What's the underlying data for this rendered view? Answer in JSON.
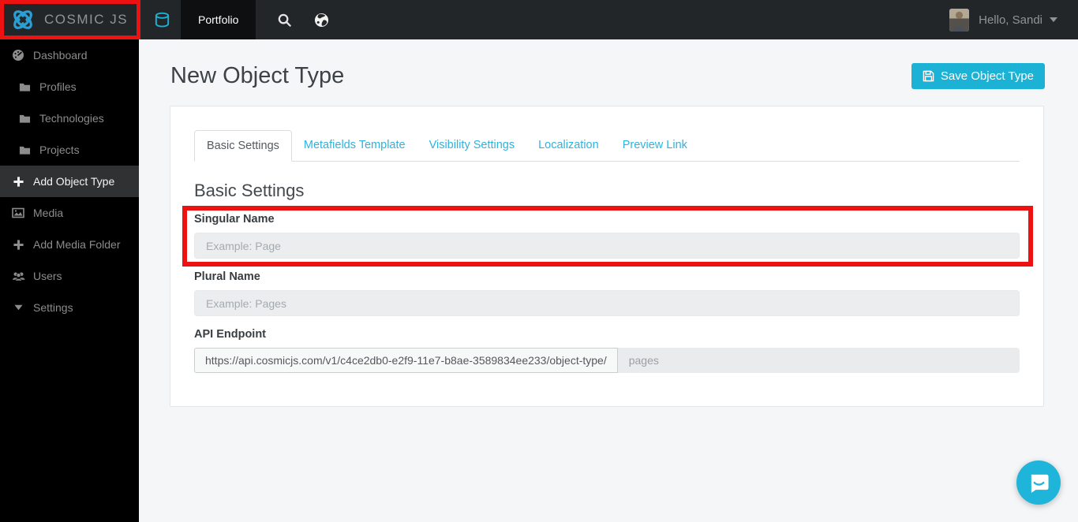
{
  "navbar": {
    "brand": "COSMIC JS",
    "active_bucket_tab": "Portfolio",
    "greeting": "Hello, Sandi",
    "icons": [
      "cosmic-logo",
      "bucket-icon",
      "search-icon",
      "globe-icon",
      "caret-down-icon"
    ]
  },
  "sidebar": {
    "items": [
      {
        "label": "Dashboard",
        "icon": "dashboard-icon",
        "indent": false,
        "active": false
      },
      {
        "label": "Profiles",
        "icon": "folder-icon",
        "indent": true,
        "active": false
      },
      {
        "label": "Technologies",
        "icon": "folder-icon",
        "indent": true,
        "active": false
      },
      {
        "label": "Projects",
        "icon": "folder-icon",
        "indent": true,
        "active": false
      },
      {
        "label": "Add Object Type",
        "icon": "plus-icon",
        "indent": false,
        "active": true,
        "annotated": true
      },
      {
        "label": "Media",
        "icon": "image-icon",
        "indent": false,
        "active": false
      },
      {
        "label": "Add Media Folder",
        "icon": "plus-icon",
        "indent": false,
        "active": false
      },
      {
        "label": "Users",
        "icon": "users-icon",
        "indent": false,
        "active": false
      },
      {
        "label": "Settings",
        "icon": "caret-down-icon",
        "indent": false,
        "active": false
      }
    ]
  },
  "page": {
    "title": "New Object Type",
    "save_button": "Save Object Type"
  },
  "tabs": [
    {
      "label": "Basic Settings",
      "active": true
    },
    {
      "label": "Metafields Template",
      "active": false
    },
    {
      "label": "Visibility Settings",
      "active": false
    },
    {
      "label": "Localization",
      "active": false
    },
    {
      "label": "Preview Link",
      "active": false
    }
  ],
  "form": {
    "section_heading": "Basic Settings",
    "singular": {
      "label": "Singular Name",
      "value": "",
      "placeholder": "Example: Page"
    },
    "plural": {
      "label": "Plural Name",
      "value": "",
      "placeholder": "Example: Pages"
    },
    "api": {
      "label": "API Endpoint",
      "prefix": "https://api.cosmicjs.com/v1/c4ce2db0-e2f9-11e7-b8ae-3589834ee233/object-type/",
      "value": "",
      "placeholder": "pages"
    }
  },
  "annotations": {
    "count": 2,
    "color": "#ee1111",
    "targets": [
      "sidebar-item-add-object-type",
      "singular-name-field"
    ]
  },
  "colors": {
    "accent_cyan": "#1cb2d6",
    "link_cyan": "#2eb3de",
    "navbar_bg": "#232629",
    "sidebar_bg": "#000000",
    "active_item_bg": "#2f3133",
    "content_bg": "#f5f6f7",
    "annotation_red": "#ee1111"
  },
  "chat": {
    "launcher": "intercom-chat"
  }
}
